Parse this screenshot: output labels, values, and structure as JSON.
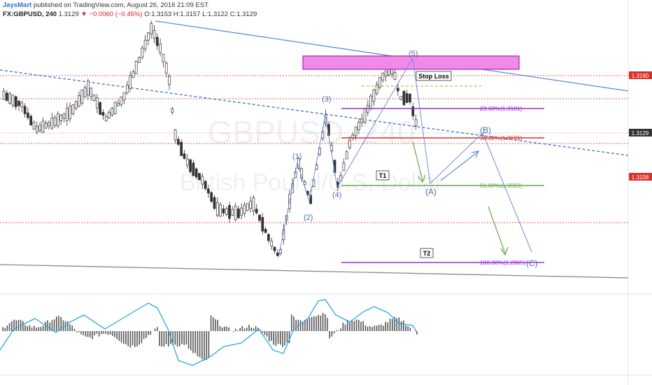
{
  "header": {
    "author": "JaysMart",
    "published": "published on TradingView.com, August 26, 2016 21:09 EST",
    "symbol": "FX:GBPUSD, 240",
    "last": "1.3129",
    "change": "▼ −0.0060 (−0.45%)",
    "ohlc": "O:1.3153 H:1.3157 L:1.3122 C:1.3129"
  },
  "watermark": {
    "symbol": "GBPUSD, 240",
    "description": "British Pound/U.S. Dollar"
  },
  "colors": {
    "up": "#ffffff",
    "down": "#333333",
    "trendline": "#5b8ed6",
    "fib": "#9b30d9",
    "fib_green": "#6aa84f",
    "red_line": "#d9302c",
    "stop_zone": "#f08ae8",
    "histogram": "#555555",
    "signal": "#29a8e0"
  },
  "price_tags": {
    "stop": "1.3190",
    "last": "1.3129",
    "low": "1.3108"
  },
  "annotations": {
    "stop_loss": "Stop Loss",
    "t1": "T1",
    "t2": "T2"
  },
  "chart_data": {
    "type": "candlestick",
    "title": "",
    "xlabel": "",
    "ylabel": "",
    "ylim": [
      1.276,
      1.328
    ],
    "grid": false,
    "fib_levels": [
      {
        "label": "23.60%(1.3181)",
        "value": 1.3181,
        "color": "#9b30d9"
      },
      {
        "label": "38.20%(1.3121)",
        "value": 1.3121,
        "color": "#d9302c"
      },
      {
        "label": "61.80%(1.3023)",
        "value": 1.3023,
        "color": "#6aa84f"
      },
      {
        "label": "100.00%(1.2865)",
        "value": 1.2865,
        "color": "#9b30d9"
      }
    ],
    "wave_labels": [
      "(1)",
      "(2)",
      "(3)",
      "(4)",
      "(5)",
      "(A)",
      "(B)",
      "(C)"
    ],
    "stop_loss_zone": [
      1.3225,
      1.3247
    ]
  }
}
